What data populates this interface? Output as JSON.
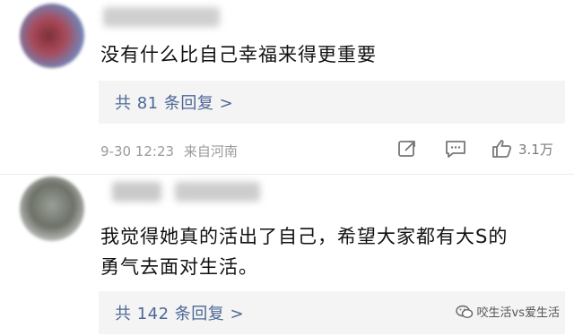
{
  "comments": [
    {
      "text": "没有什么比自己幸福来得更重要",
      "replies_label": "共 81 条回复 >",
      "timestamp": "9-30 12:23",
      "location": "来自河南",
      "like_count": "3.1万"
    },
    {
      "text_line1": "我觉得她真的活出了自己，希望大家都有大S的",
      "text_line2": "勇气去面对生活。",
      "replies_label": "共 142 条回复 >"
    }
  ],
  "watermark": "咬生活vs爱生活",
  "icons": [
    "share-icon",
    "comment-icon",
    "like-icon",
    "wechat-icon"
  ]
}
